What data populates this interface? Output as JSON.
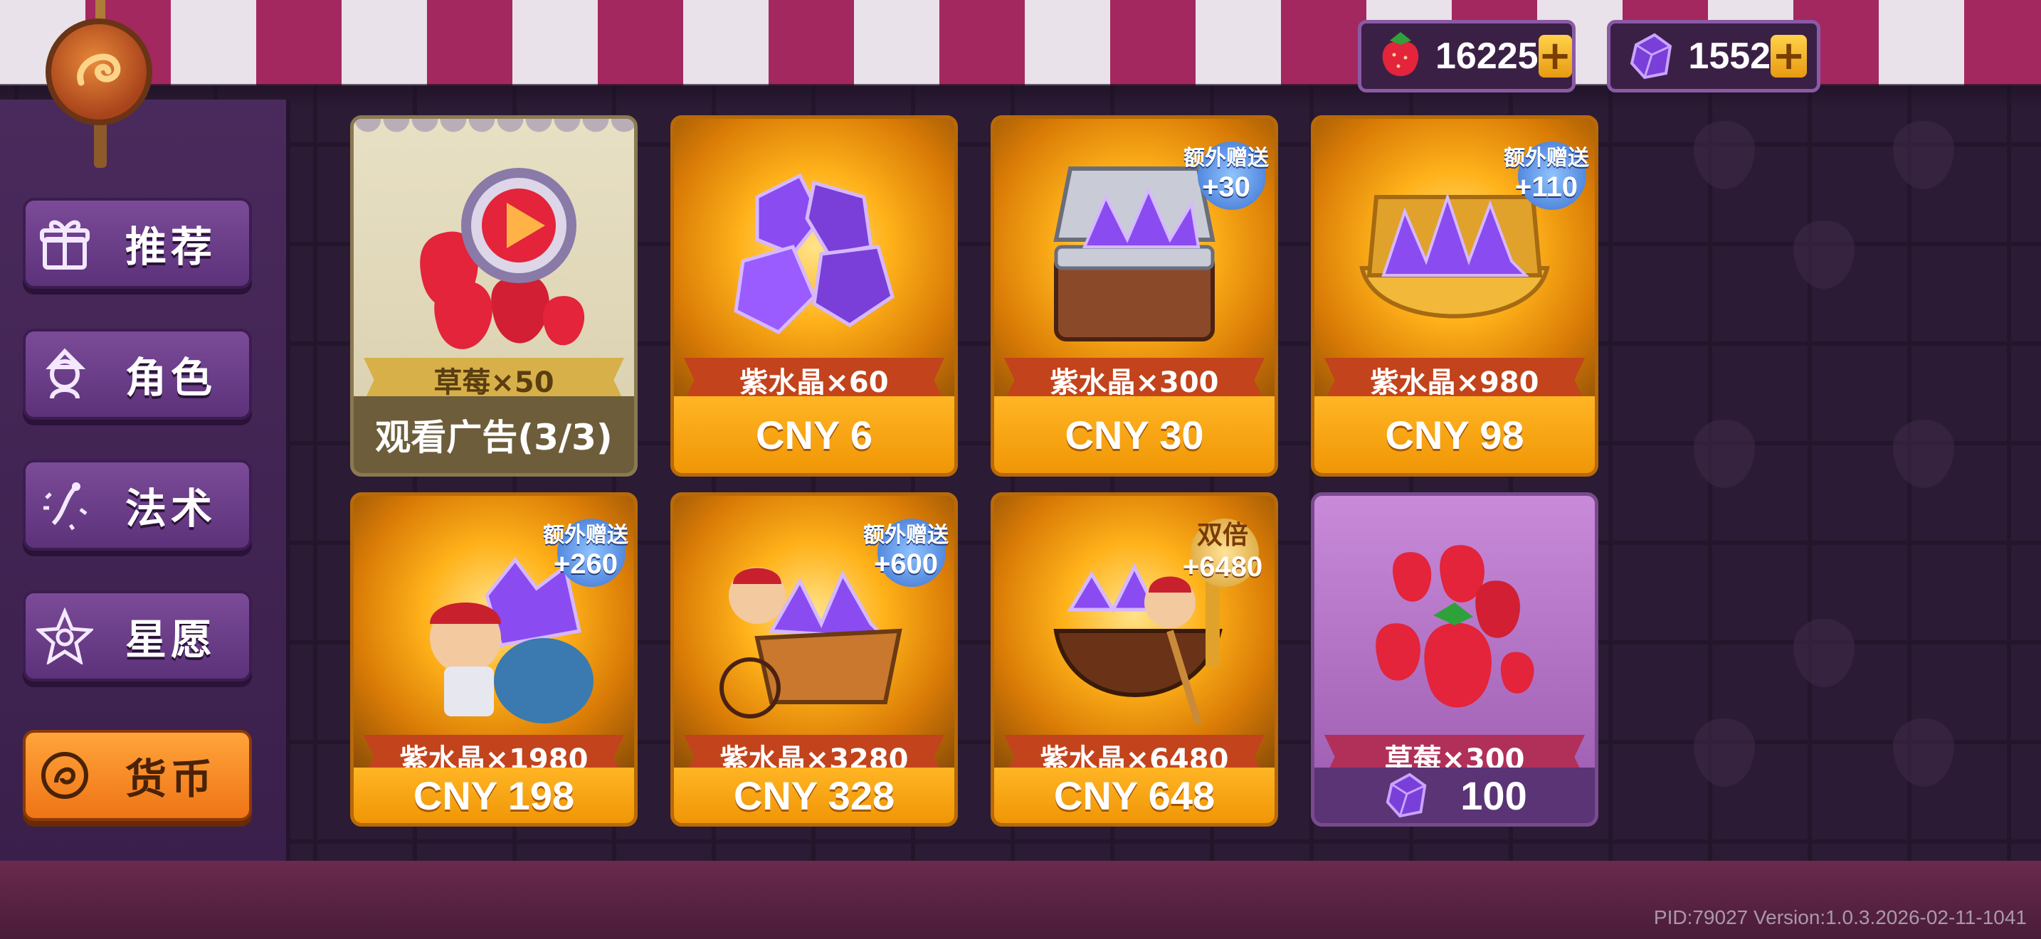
{
  "currency": {
    "strawberry": {
      "icon": "strawberry-icon",
      "value": "16225"
    },
    "crystal": {
      "icon": "purple-crystal-icon",
      "value": "1552"
    },
    "plus_label": "+"
  },
  "sidebar": {
    "items": [
      {
        "label": "推荐",
        "icon": "gift-icon",
        "active": false
      },
      {
        "label": "角色",
        "icon": "character-icon",
        "active": false
      },
      {
        "label": "法术",
        "icon": "spell-icon",
        "active": false
      },
      {
        "label": "星愿",
        "icon": "star-wish-icon",
        "active": false
      },
      {
        "label": "货币",
        "icon": "coin-icon",
        "active": true
      }
    ]
  },
  "cards": [
    {
      "item": "草莓×50",
      "price": "观看广告(3/3)",
      "type": "ad"
    },
    {
      "item": "紫水晶×60",
      "price": "CNY 6"
    },
    {
      "item": "紫水晶×300",
      "price": "CNY 30",
      "bonus_label": "额外赠送",
      "bonus_value": "+30"
    },
    {
      "item": "紫水晶×980",
      "price": "CNY 98",
      "bonus_label": "额外赠送",
      "bonus_value": "+110"
    },
    {
      "item": "紫水晶×1980",
      "price": "CNY 198",
      "bonus_label": "额外赠送",
      "bonus_value": "+260"
    },
    {
      "item": "紫水晶×3280",
      "price": "CNY 328",
      "bonus_label": "额外赠送",
      "bonus_value": "+600"
    },
    {
      "item": "紫水晶×6480",
      "price": "CNY 648",
      "bonus_label": "双倍",
      "bonus_value": "+6480"
    },
    {
      "item": "草莓×300",
      "price": "100",
      "type": "strawberry"
    }
  ],
  "footer": {
    "version": "PID:79027  Version:1.0.3.2026-02-11-1041"
  },
  "colors": {
    "accent_orange": "#f09606",
    "purple": "#5c327a",
    "awning_red": "#a3285f"
  }
}
